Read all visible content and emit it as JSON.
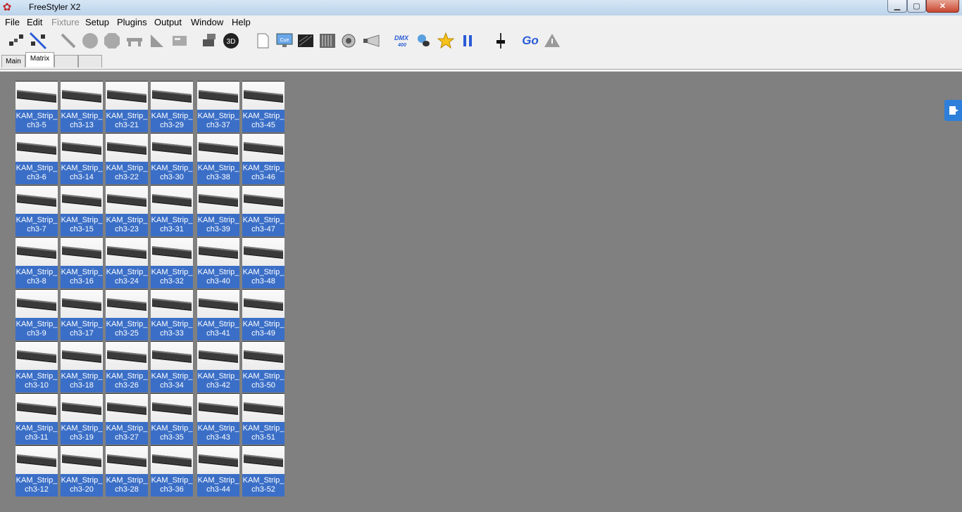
{
  "window": {
    "title": "FreeStyler X2"
  },
  "menu": [
    {
      "label": "File",
      "disabled": false
    },
    {
      "label": "Edit",
      "disabled": false
    },
    {
      "label": "Fixture",
      "disabled": true
    },
    {
      "label": "Setup",
      "disabled": false
    },
    {
      "label": "Plugins",
      "disabled": false
    },
    {
      "label": "Output",
      "disabled": false
    },
    {
      "label": "Window",
      "disabled": false
    },
    {
      "label": "Help",
      "disabled": false
    }
  ],
  "toolbar": {
    "dmx_label_top": "DMX",
    "dmx_label_bottom": "400",
    "go_label": "Go",
    "cue_label": "Cue",
    "three_d_label": "3D"
  },
  "tabs": [
    {
      "label": "Main",
      "active": false
    },
    {
      "label": "Matrix",
      "active": true
    },
    {
      "label": "",
      "active": false
    },
    {
      "label": "",
      "active": false
    }
  ],
  "fixtures": [
    [
      "KAM_Strip_",
      "ch3-5"
    ],
    [
      "KAM_Strip_",
      "ch3-13"
    ],
    [
      "KAM_Strip_",
      "ch3-21"
    ],
    [
      "KAM_Strip_",
      "ch3-29"
    ],
    [
      "KAM_Strip_",
      "ch3-37"
    ],
    [
      "KAM_Strip_",
      "ch3-45"
    ],
    [
      "KAM_Strip_",
      "ch3-6"
    ],
    [
      "KAM_Strip_",
      "ch3-14"
    ],
    [
      "KAM_Strip_",
      "ch3-22"
    ],
    [
      "KAM_Strip_",
      "ch3-30"
    ],
    [
      "KAM_Strip_",
      "ch3-38"
    ],
    [
      "KAM_Strip_",
      "ch3-46"
    ],
    [
      "KAM_Strip_",
      "ch3-7"
    ],
    [
      "KAM_Strip_",
      "ch3-15"
    ],
    [
      "KAM_Strip_",
      "ch3-23"
    ],
    [
      "KAM_Strip_",
      "ch3-31"
    ],
    [
      "KAM_Strip_",
      "ch3-39"
    ],
    [
      "KAM_Strip_",
      "ch3-47"
    ],
    [
      "KAM_Strip_",
      "ch3-8"
    ],
    [
      "KAM_Strip_",
      "ch3-16"
    ],
    [
      "KAM_Strip_",
      "ch3-24"
    ],
    [
      "KAM_Strip_",
      "ch3-32"
    ],
    [
      "KAM_Strip_",
      "ch3-40"
    ],
    [
      "KAM_Strip_",
      "ch3-48"
    ],
    [
      "KAM_Strip_",
      "ch3-9"
    ],
    [
      "KAM_Strip_",
      "ch3-17"
    ],
    [
      "KAM_Strip_",
      "ch3-25"
    ],
    [
      "KAM_Strip_",
      "ch3-33"
    ],
    [
      "KAM_Strip_",
      "ch3-41"
    ],
    [
      "KAM_Strip_",
      "ch3-49"
    ],
    [
      "KAM_Strip_",
      "ch3-10"
    ],
    [
      "KAM_Strip_",
      "ch3-18"
    ],
    [
      "KAM_Strip_",
      "ch3-26"
    ],
    [
      "KAM_Strip_",
      "ch3-34"
    ],
    [
      "KAM_Strip_",
      "ch3-42"
    ],
    [
      "KAM_Strip_",
      "ch3-50"
    ],
    [
      "KAM_Strip_",
      "ch3-11"
    ],
    [
      "KAM_Strip_",
      "ch3-19"
    ],
    [
      "KAM_Strip_",
      "ch3-27"
    ],
    [
      "KAM_Strip_",
      "ch3-35"
    ],
    [
      "KAM_Strip_",
      "ch3-43"
    ],
    [
      "KAM_Strip_",
      "ch3-51"
    ],
    [
      "KAM_Strip_",
      "ch3-12"
    ],
    [
      "KAM_Strip_",
      "ch3-20"
    ],
    [
      "KAM_Strip_",
      "ch3-28"
    ],
    [
      "KAM_Strip_",
      "ch3-36"
    ],
    [
      "KAM_Strip_",
      "ch3-44"
    ],
    [
      "KAM_Strip_",
      "ch3-52"
    ]
  ],
  "colors": {
    "workspace": "#808080",
    "label_bg": "#3b6fc7",
    "accent": "#2d7fd9"
  }
}
